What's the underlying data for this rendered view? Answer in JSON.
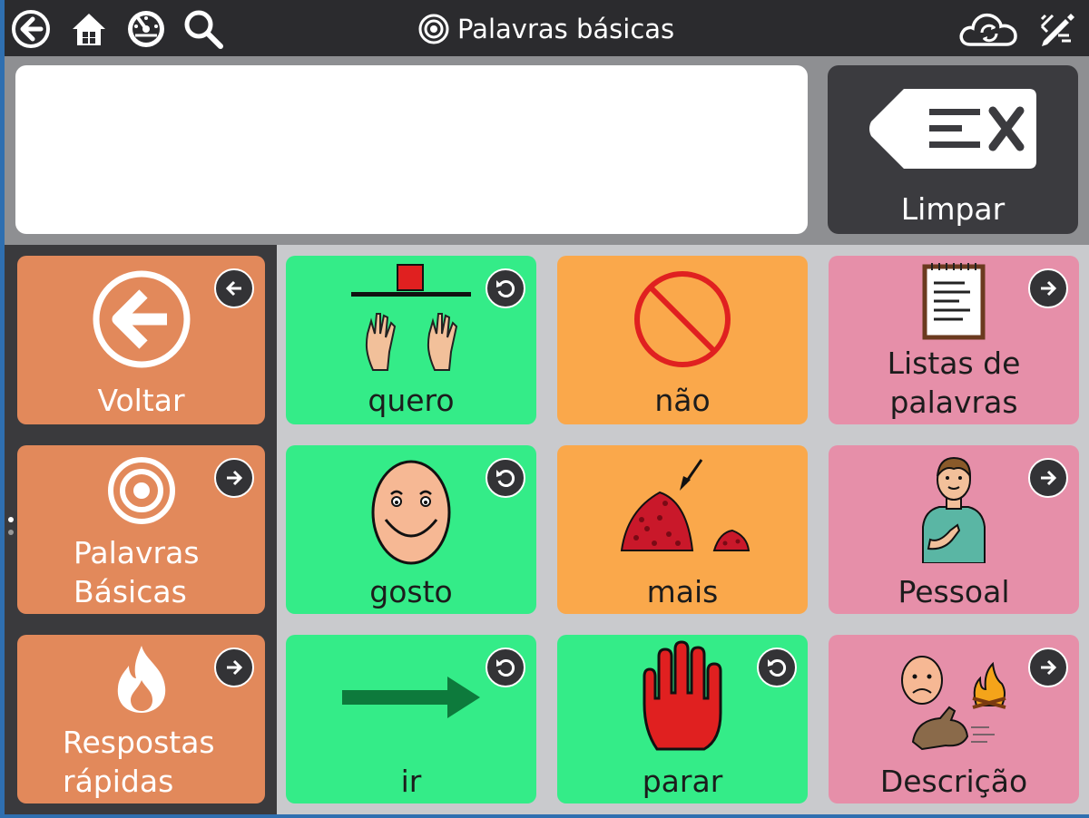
{
  "topbar": {
    "title": "Palavras básicas",
    "icons": [
      "back-circle-icon",
      "home-icon",
      "speedometer-icon",
      "search-icon",
      "cloud-sync-icon",
      "edit-pencil-icon"
    ]
  },
  "message_bar": {
    "text": "",
    "clear_label": "Limpar",
    "clear_icon": "backspace-clear-icon"
  },
  "tiles": {
    "voltar": {
      "label": "Voltar",
      "icon": "arrow-left-circle-icon",
      "badge": "arrow-left-badge-icon"
    },
    "palavras_basicas": {
      "label_line1": "Palavras",
      "label_line2": "Básicas",
      "icon": "target-icon",
      "badge": "arrow-right-badge-icon"
    },
    "respostas_rapidas": {
      "label_line1": "Respostas",
      "label_line2": "rápidas",
      "icon": "flame-icon",
      "badge": "arrow-right-badge-icon"
    },
    "quero": {
      "label": "quero",
      "icon": "hands-reaching-icon",
      "badge": "undo-badge-icon"
    },
    "nao": {
      "label": "não",
      "icon": "prohibited-icon"
    },
    "listas": {
      "label_line1": "Listas de",
      "label_line2": "palavras",
      "icon": "notepad-icon",
      "badge": "arrow-right-badge-icon"
    },
    "gosto": {
      "label": "gosto",
      "icon": "smiling-face-icon",
      "badge": "undo-badge-icon"
    },
    "mais": {
      "label": "mais",
      "icon": "pile-more-icon"
    },
    "pessoal": {
      "label": "Pessoal",
      "icon": "person-pointing-self-icon",
      "badge": "arrow-right-badge-icon"
    },
    "ir": {
      "label": "ir",
      "icon": "arrow-right-green-icon",
      "badge": "undo-badge-icon"
    },
    "parar": {
      "label": "parar",
      "icon": "stop-hand-icon",
      "badge": "undo-badge-icon"
    },
    "descricao": {
      "label": "Descrição",
      "icon": "describe-collage-icon",
      "badge": "arrow-right-badge-icon"
    }
  },
  "colors": {
    "topbar": "#2b2b2e",
    "nav_tile": "#e2895b",
    "verb_tile": "#34ec88",
    "negation_tile": "#faa84b",
    "folder_tile": "#e68fa9"
  }
}
